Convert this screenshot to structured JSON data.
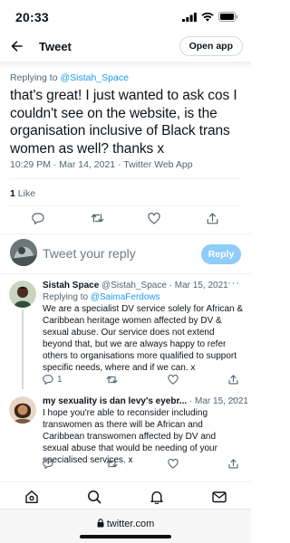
{
  "status_bar": {
    "time": "20:33"
  },
  "header": {
    "title": "Tweet",
    "open_app_label": "Open app"
  },
  "tweet": {
    "replying_prefix": "Replying to",
    "replying_handle": "@Sistah_Space",
    "text": "that's great! I just wanted to ask cos I couldn't see on the website, is the organisation inclusive of Black trans women as well? thanks x",
    "meta": "10:29 PM · Mar 14, 2021 · Twitter Web App",
    "likes_count": "1",
    "likes_label": "Like"
  },
  "composer": {
    "placeholder": "Tweet your reply",
    "reply_label": "Reply"
  },
  "replies": [
    {
      "name": "Sistah Space",
      "handle_date": "@Sistah_Space · Mar 15, 2021",
      "replying_prefix": "Replying to",
      "replying_handle": "@SaimaFerdows",
      "text": "We are a specialist DV service solely for African & Caribbean heritage women affected by DV & sexual abuse. Our service does not extend beyond that, but we are always happy to refer others to organisations more qualified to support specific needs, where and if we can. x",
      "reply_count": "1"
    },
    {
      "name": "my sexuality is dan levy's eyebr...",
      "handle_date": "· Mar 15, 2021",
      "text": "I hope you're able to reconsider including transwomen as there will be African and Caribbean transwomen affected by DV and sexual abuse that would be needing of your specialised services. x"
    }
  ],
  "browser": {
    "url": "twitter.com"
  },
  "icons": {
    "back": "back-arrow-icon",
    "reply": "reply-icon",
    "retweet": "retweet-icon",
    "like": "heart-icon",
    "share": "share-icon",
    "home": "home-icon",
    "search": "search-icon",
    "notifications": "bell-icon",
    "messages": "mail-icon"
  },
  "colors": {
    "accent": "#1d9bf0",
    "reply_button_disabled": "#8ecdf7",
    "secondary_text": "#536471"
  }
}
